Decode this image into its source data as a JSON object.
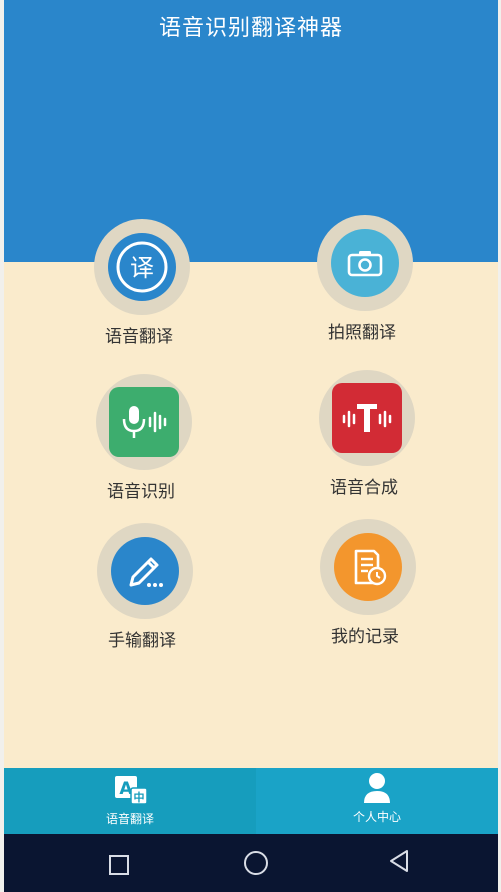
{
  "app": {
    "title": "语音识别翻译神器"
  },
  "features": [
    {
      "label": "语音翻译",
      "icon": "translate-badge-icon"
    },
    {
      "label": "拍照翻译",
      "icon": "camera-icon"
    },
    {
      "label": "语音识别",
      "icon": "microphone-icon"
    },
    {
      "label": "语音合成",
      "icon": "text-to-speech-icon"
    },
    {
      "label": "手输翻译",
      "icon": "pencil-icon"
    },
    {
      "label": "我的记录",
      "icon": "history-icon"
    }
  ],
  "tabbar": {
    "tabs": [
      {
        "label": "语音翻译",
        "active": true
      },
      {
        "label": "个人中心",
        "active": false
      }
    ]
  },
  "colors": {
    "header": "#2a86cb",
    "background": "#faebcc",
    "tabbar": "#1aa3c7",
    "navbar": "#0a1531"
  }
}
